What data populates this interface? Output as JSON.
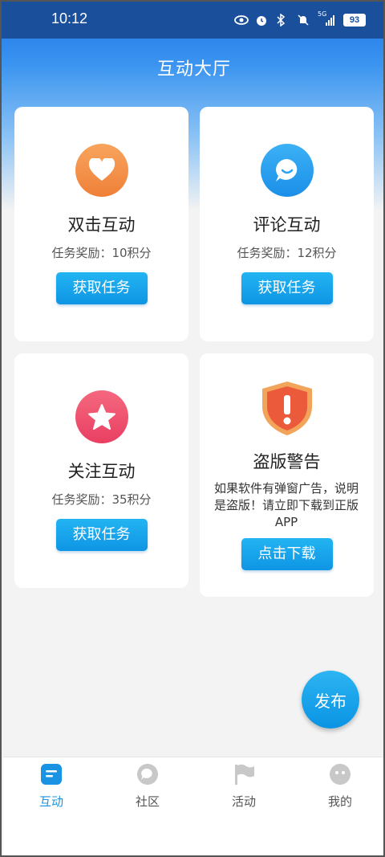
{
  "status_bar": {
    "time": "10:12",
    "network": "5G",
    "battery": "93"
  },
  "header": {
    "title": "互动大厅"
  },
  "cards": [
    {
      "name": "双击互动",
      "reward": "任务奖励：10积分",
      "button": "获取任务",
      "icon": "heart-icon",
      "color": "#f5954a"
    },
    {
      "name": "评论互动",
      "reward": "任务奖励：12积分",
      "button": "获取任务",
      "icon": "chat-bubble-icon",
      "color": "#2aa3ef"
    },
    {
      "name": "关注互动",
      "reward": "任务奖励：35积分",
      "button": "获取任务",
      "icon": "star-icon",
      "color": "#ef5472"
    }
  ],
  "warning_card": {
    "title": "盗版警告",
    "description": "如果软件有弹窗广告，说明是盗版！请立即下载到正版APP",
    "button": "点击下载",
    "icon": "warning-shield-icon"
  },
  "fab": {
    "label": "发布"
  },
  "tabbar": {
    "items": [
      {
        "label": "互动",
        "icon": "interact-icon",
        "active": true
      },
      {
        "label": "社区",
        "icon": "community-icon",
        "active": false
      },
      {
        "label": "活动",
        "icon": "flag-icon",
        "active": false
      },
      {
        "label": "我的",
        "icon": "profile-icon",
        "active": false
      }
    ]
  },
  "colors": {
    "accent": "#1a94e2",
    "header_top": "#1e73e8",
    "status_bar": "#1a4f9c"
  }
}
